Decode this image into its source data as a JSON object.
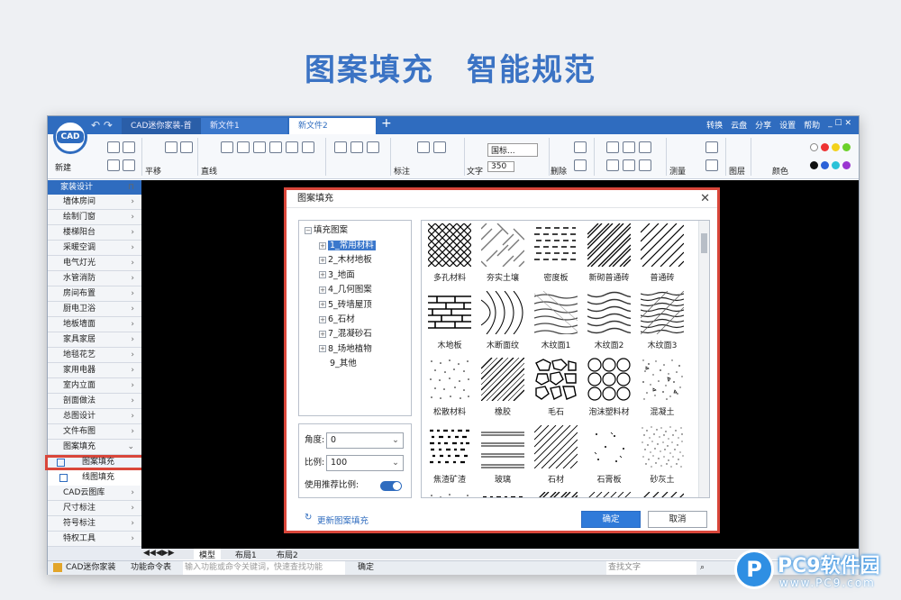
{
  "headline": "图案填充　智能规范",
  "app": {
    "tabs": [
      "CAD迷你家装-首页",
      "新文件1",
      "新文件2"
    ],
    "top_menu": [
      "转换",
      "云盘",
      "分享",
      "设置",
      "帮助"
    ],
    "logo_text": "CAD",
    "new_label": "新建",
    "ribbon_labels": {
      "pan": "平移",
      "line": "直线",
      "annotate": "标注",
      "text": "文字",
      "font": "国标...",
      "size": "350",
      "delete": "删除",
      "measure": "测量",
      "layer": "图层",
      "color": "颜色"
    }
  },
  "sidebar": {
    "header": "家装设计",
    "items": [
      "墙体房间",
      "绘制门窗",
      "楼梯阳台",
      "采暖空调",
      "电气灯光",
      "水管消防",
      "房间布置",
      "厨电卫浴",
      "地板墙面",
      "家具家居",
      "地毯花艺",
      "家用电器",
      "室内立面",
      "剖面做法",
      "总图设计",
      "文件布图",
      "图案填充"
    ],
    "subitems": [
      "图案填充",
      "线图填充"
    ],
    "bottom_items": [
      "CAD云图库",
      "尺寸标注",
      "符号标注",
      "特权工具"
    ]
  },
  "layout_tabs": [
    "模型",
    "布局1",
    "布局2"
  ],
  "statusbar": {
    "app_name": "CAD迷你家装",
    "command_label": "功能命令表",
    "command_placeholder": "输入功能或命令关键词，快速查找功能",
    "confirm": "确定",
    "search_placeholder": "查找文字"
  },
  "dialog": {
    "title": "图案填充",
    "tree_root": "填充图案",
    "tree_items": [
      "1_常用材料",
      "2_木材地板",
      "3_地面",
      "4_几何图案",
      "5_砖墙屋顶",
      "6_石材",
      "7_混凝砂石",
      "8_场地植物",
      "9_其他"
    ],
    "angle_label": "角度:",
    "angle_value": "0",
    "scale_label": "比例:",
    "scale_value": "100",
    "recommend_label": "使用推荐比例:",
    "update_link": "更新图案填充",
    "ok": "确定",
    "cancel": "取消",
    "patterns": [
      "多孔材料",
      "夯实土壤",
      "密度板",
      "新砌普通砖",
      "普通砖",
      "木地板",
      "木断面纹",
      "木纹面1",
      "木纹面2",
      "木纹面3",
      "松散材料",
      "橡胶",
      "毛石",
      "泡沫塑料材",
      "混凝土",
      "焦渣矿渣",
      "玻璃",
      "石材",
      "石膏板",
      "砂灰土"
    ]
  },
  "watermark": {
    "brand": "PC9软件园",
    "url": "www.PC9.com"
  },
  "colors": {
    "brand_blue": "#2f6cbf",
    "highlight_red": "#d9463a"
  }
}
